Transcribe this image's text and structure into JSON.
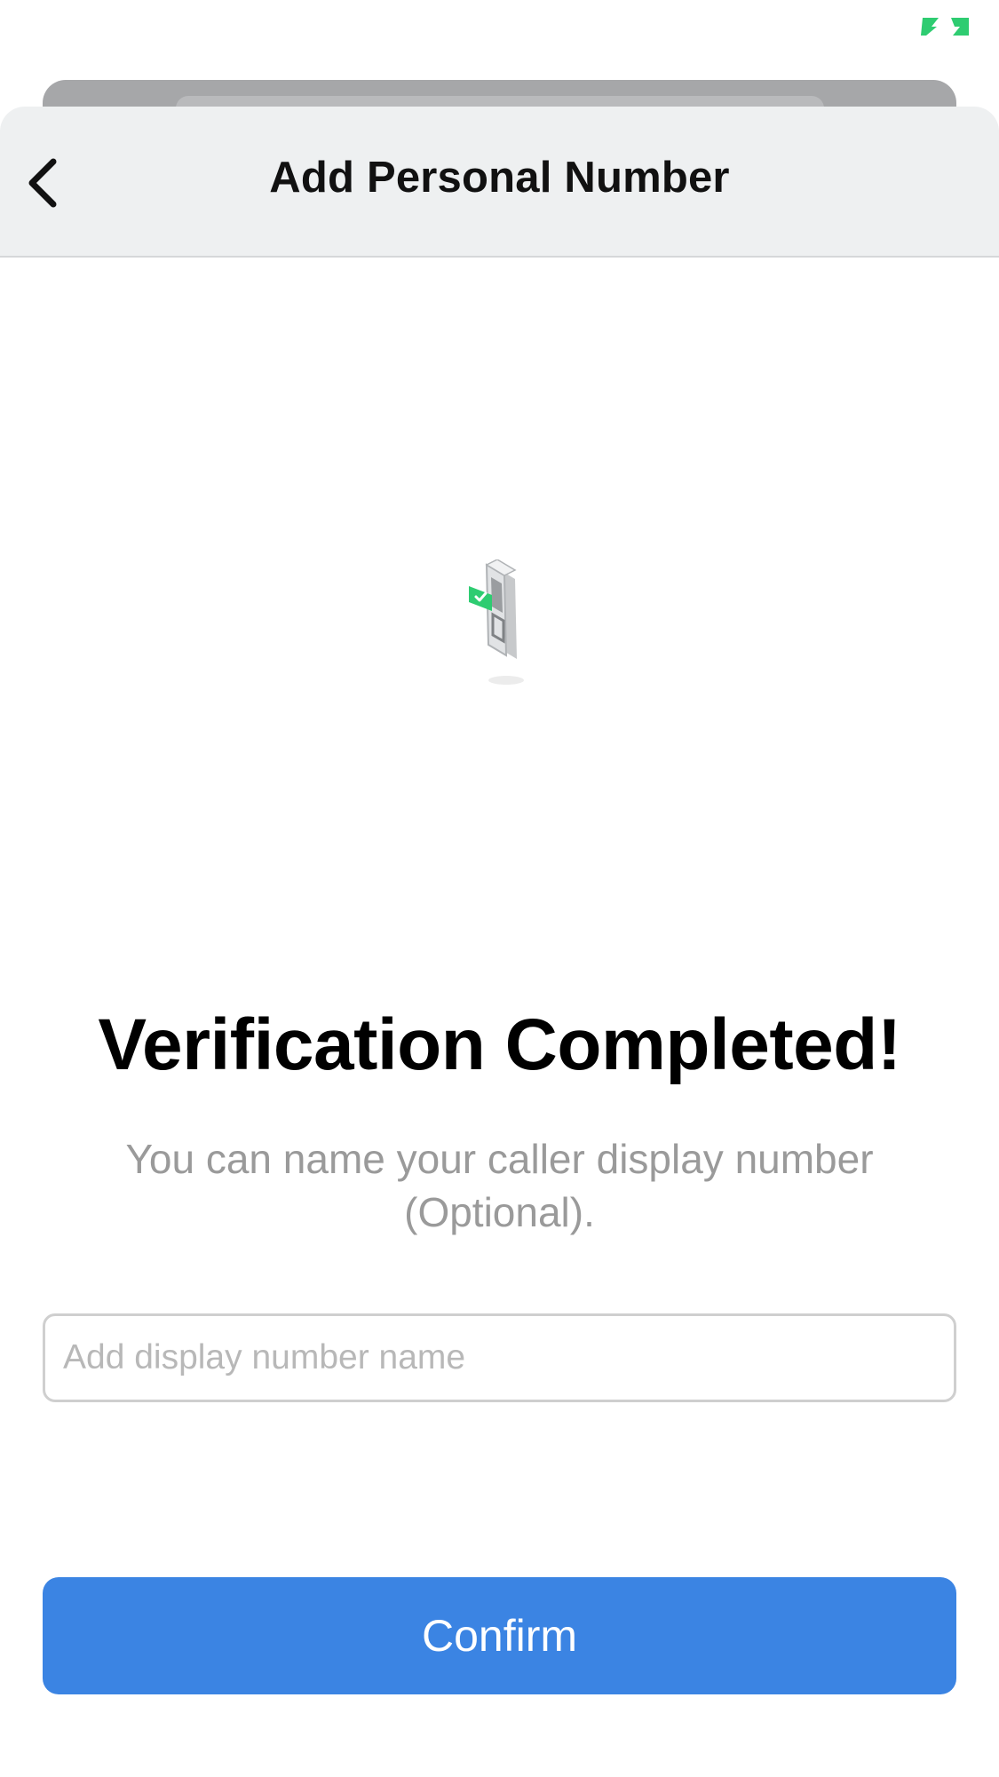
{
  "header": {
    "title": "Add Personal Number",
    "back_icon": "chevron-left-icon"
  },
  "status_bar": {
    "indicator_icon": "battery-charging-icon",
    "indicator_color": "#2ecc71"
  },
  "main": {
    "illustration_icon": "phone-verified-illustration",
    "headline": "Verification Completed!",
    "subtext": "You can name your caller display number (Optional).",
    "name_input": {
      "value": "",
      "placeholder": "Add display number name"
    },
    "confirm_label": "Confirm"
  },
  "colors": {
    "accent": "#3b84e3",
    "success": "#2ecc71",
    "nav_background": "#eef0f1",
    "secondary_text": "#9a9a9a"
  }
}
